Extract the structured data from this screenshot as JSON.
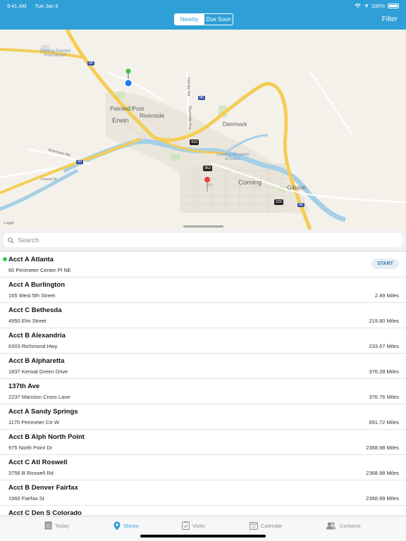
{
  "status_bar": {
    "time": "9:41 AM",
    "date": "Tue Jan 9",
    "battery": "100%"
  },
  "header": {
    "segments": [
      "Nearby",
      "Due Soon"
    ],
    "selected_segment": "Nearby",
    "filter_label": "Filter",
    "accent_color": "#2f9fd8"
  },
  "map": {
    "labels": {
      "airport": "Corning-Painted Post Airport",
      "painted_post": "Painted Post",
      "riverside": "Riverside",
      "erwin": "Erwin",
      "denmark": "Denmark",
      "corning": "Corning",
      "gibson": "Gibson",
      "museum": "Corning Museum of Glass",
      "beartown": "Beartown Rd",
      "forest": "Forest Dr",
      "hornby": "Hornby Rd",
      "reynolds": "Reynolds Ave"
    },
    "shields": {
      "i86_a": "86",
      "i86_b": "86",
      "i99": "99",
      "i86_c": "86",
      "r415": "415",
      "r352": "352",
      "r225": "225"
    },
    "legal": "Legal"
  },
  "search": {
    "placeholder": "Search"
  },
  "stores": [
    {
      "name": "Acct A Atlanta",
      "address": "60 Perimeter Center Pl NE",
      "distance": "",
      "action": "START"
    },
    {
      "name": "Acct A Burlington",
      "address": "165 West 5th Street",
      "distance": "2.49 Miles"
    },
    {
      "name": "Acct C Bethesda",
      "address": "4950 Elm Street",
      "distance": "219.80 Miles"
    },
    {
      "name": "Acct B Alexandria",
      "address": "6303 Richmond Hwy",
      "distance": "233.67 Miles"
    },
    {
      "name": "Acct B Alpharetta",
      "address": "1837 Kensal Green Drive",
      "distance": "376.28 Miles"
    },
    {
      "name": "137th Ave",
      "address": "2237 Mansion Cross Lane",
      "distance": "376.76 Miles"
    },
    {
      "name": "Acct A Sandy Springs",
      "address": "1170 Perimeter Ctr W",
      "distance": "691.72 Miles"
    },
    {
      "name": "Acct B Alph North Point",
      "address": "975 North Point Dr",
      "distance": "2368.98 Miles"
    },
    {
      "name": "Acct C Atl Roswell",
      "address": "3756 B Roswell Rd",
      "distance": "2368.98 Miles"
    },
    {
      "name": "Acct B Denver Fairfax",
      "address": "1960 Fairfax St",
      "distance": "2368.99 Miles"
    },
    {
      "name": "Acct C Den S Colorado",
      "address": "",
      "distance": ""
    }
  ],
  "tabs": [
    {
      "label": "Today",
      "icon": "today-icon"
    },
    {
      "label": "Stores",
      "icon": "location-pin-icon",
      "active": true
    },
    {
      "label": "Visits",
      "icon": "visits-icon"
    },
    {
      "label": "Calendar",
      "icon": "calendar-icon",
      "badge": "11"
    },
    {
      "label": "Contacts",
      "icon": "contacts-icon"
    }
  ]
}
